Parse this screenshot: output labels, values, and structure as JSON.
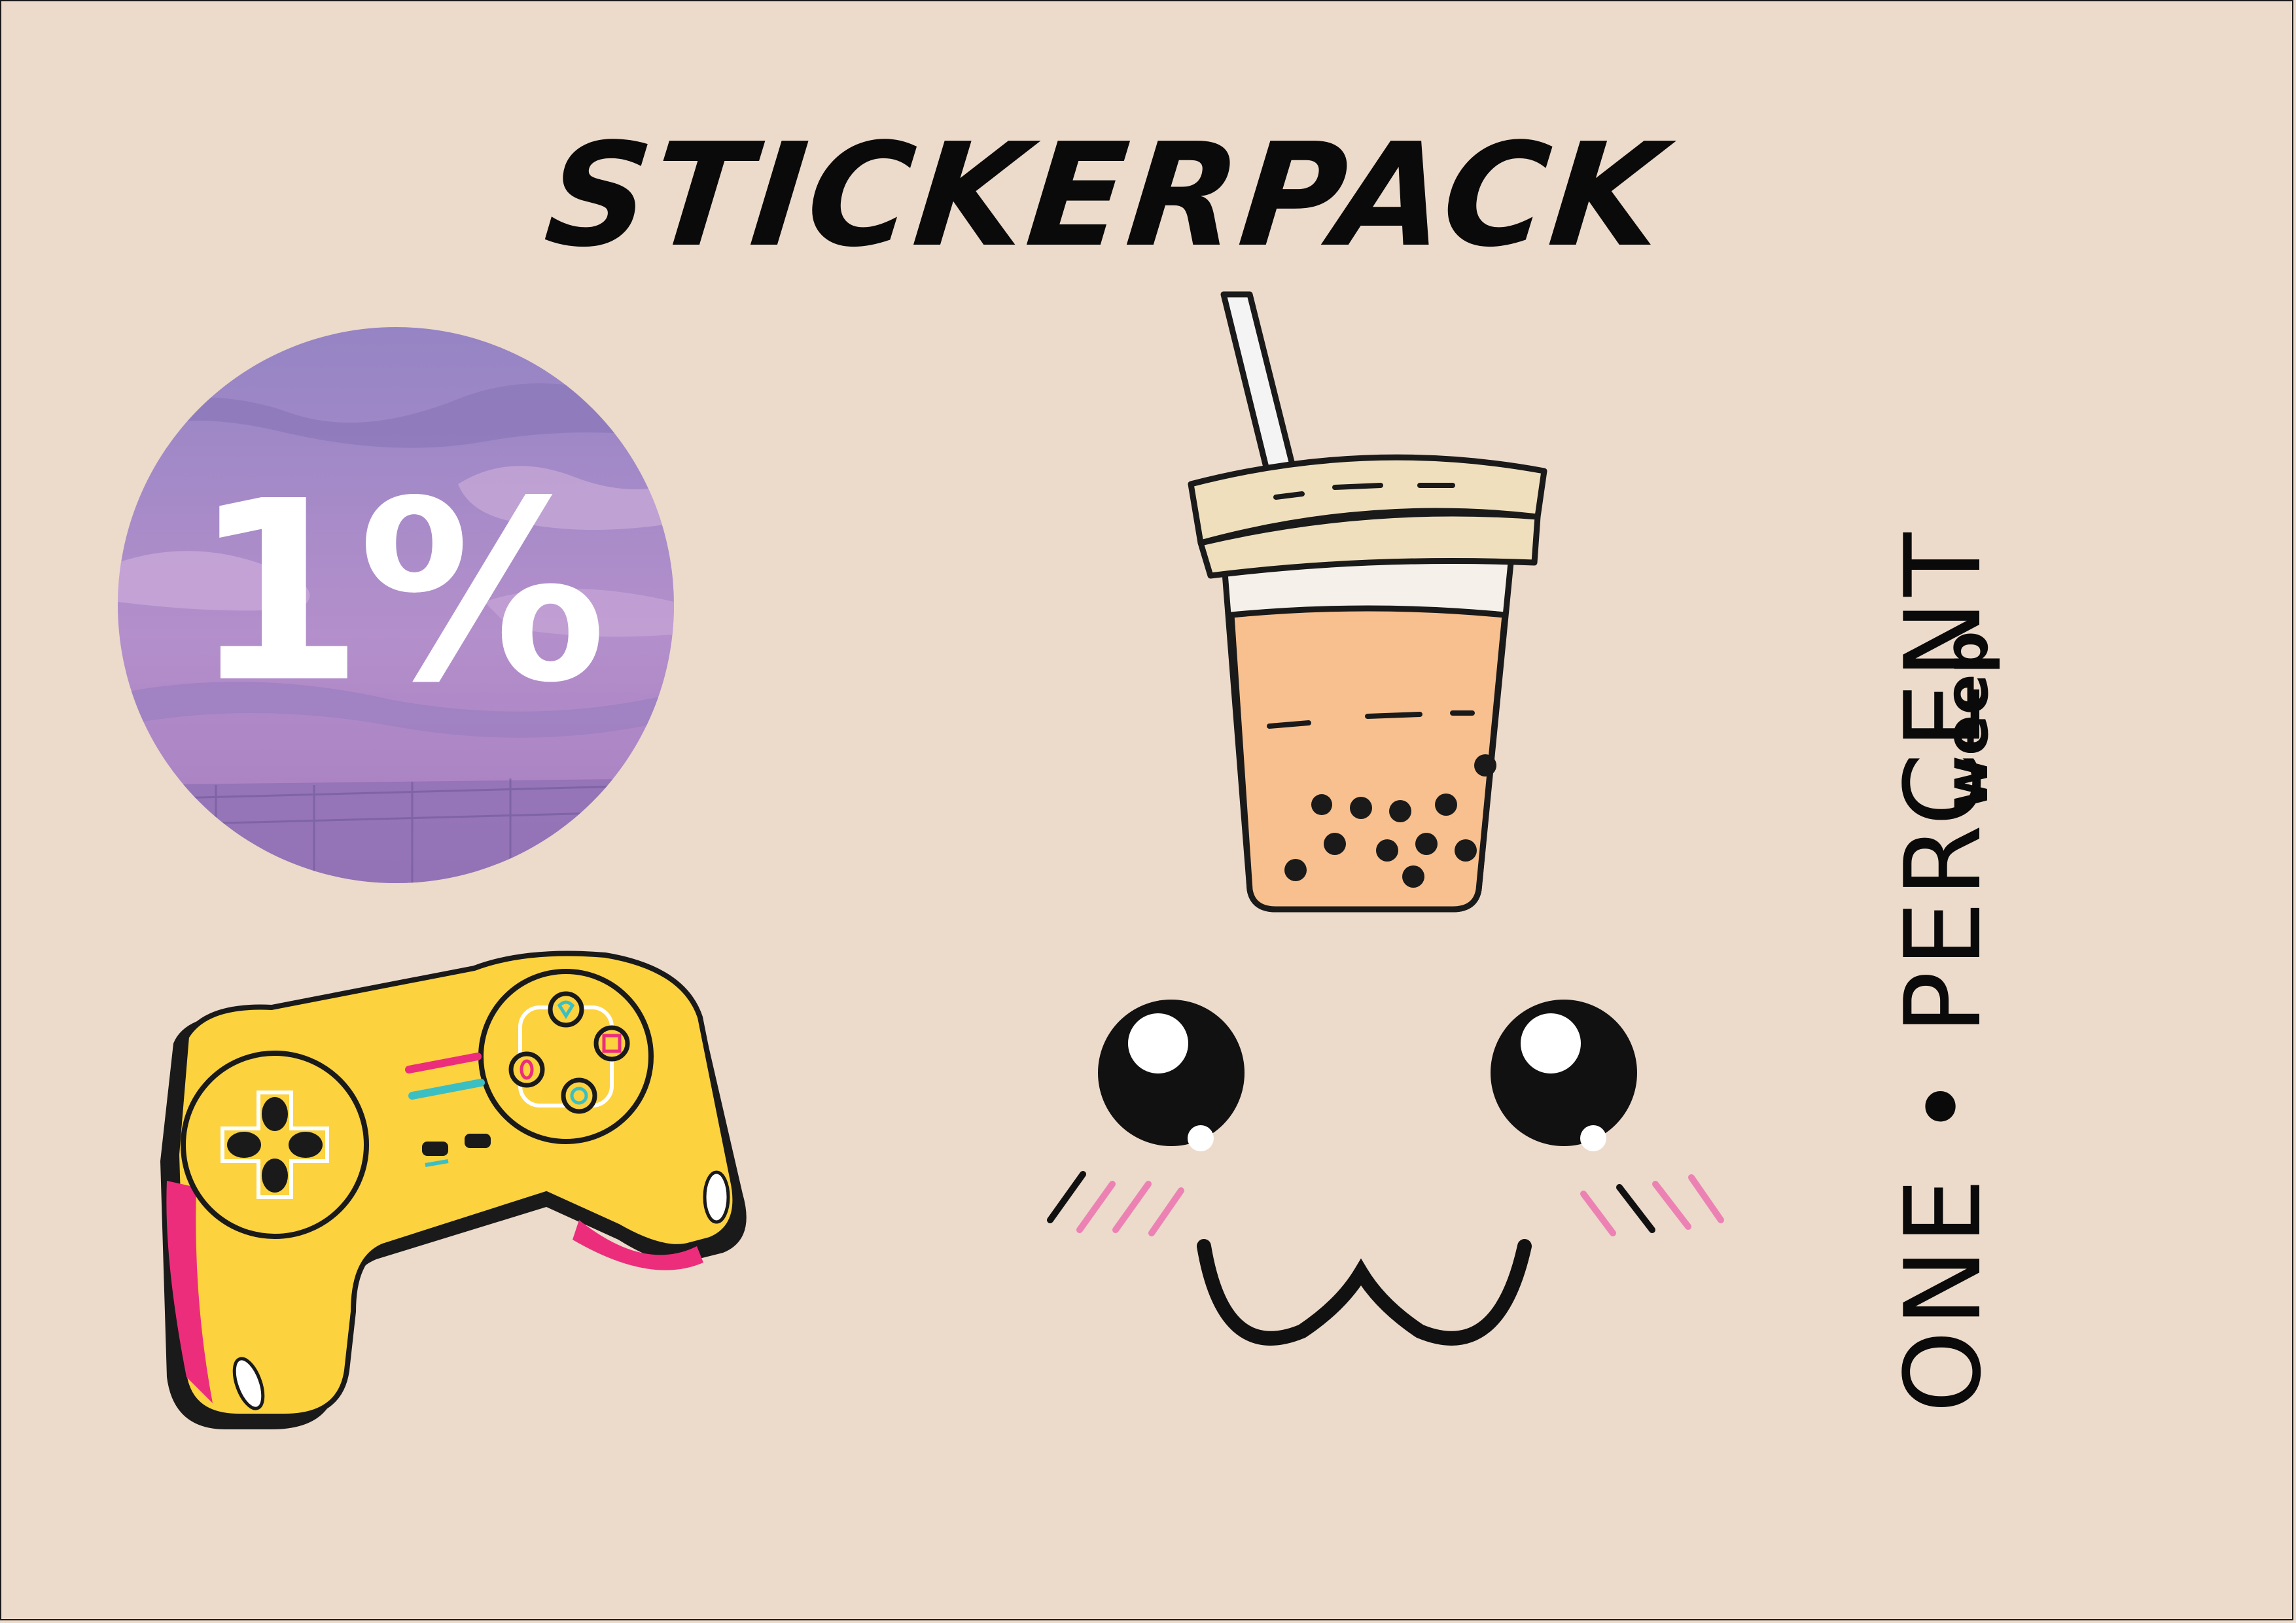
{
  "header": {
    "title": "STICKERPACK"
  },
  "stickers": {
    "badge": {
      "label": "1%",
      "icon": "one-percent-badge-icon"
    },
    "cup": {
      "icon": "bubble-tea-icon"
    },
    "controller": {
      "icon": "game-controller-icon"
    },
    "face": {
      "icon": "kawaii-face-icon"
    }
  },
  "brand": {
    "name": "ONE • PERCENT",
    "sub": "weep"
  },
  "colors": {
    "background": "#ecdacb",
    "text": "#0a0a0a",
    "badge_purple": "#a98bc6",
    "tea": "#f7c08e",
    "lid": "#efdfbd",
    "controller_yellow": "#fcd23f",
    "controller_pink": "#ec2d7c",
    "controller_teal": "#3bbfc3",
    "blush": "#ec82b3"
  }
}
